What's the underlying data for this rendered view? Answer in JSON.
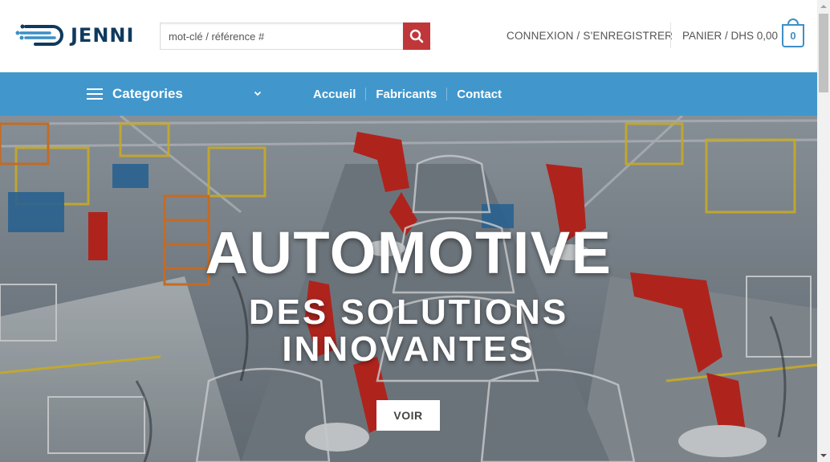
{
  "brand": {
    "name": "JENNI"
  },
  "search": {
    "placeholder": "mot-clé / référence #",
    "value": "",
    "button_icon": "search-icon"
  },
  "account": {
    "label": "CONNEXION / S'ENREGISTRER"
  },
  "cart": {
    "label": "PANIER / DHS 0,00",
    "count": "0"
  },
  "nav": {
    "categories_label": "Categories",
    "links": [
      {
        "label": "Accueil"
      },
      {
        "label": "Fabricants"
      },
      {
        "label": "Contact"
      }
    ]
  },
  "hero": {
    "title": "AUTOMOTIVE",
    "subtitle_line1": "DES SOLUTIONS",
    "subtitle_line2": "INNOVANTES",
    "button_label": "VOIR"
  },
  "colors": {
    "accent_blue": "#4197cc",
    "search_red": "#c0373a",
    "logo_navy": "#0f3a5f",
    "cart_blue": "#3d8fc6"
  }
}
